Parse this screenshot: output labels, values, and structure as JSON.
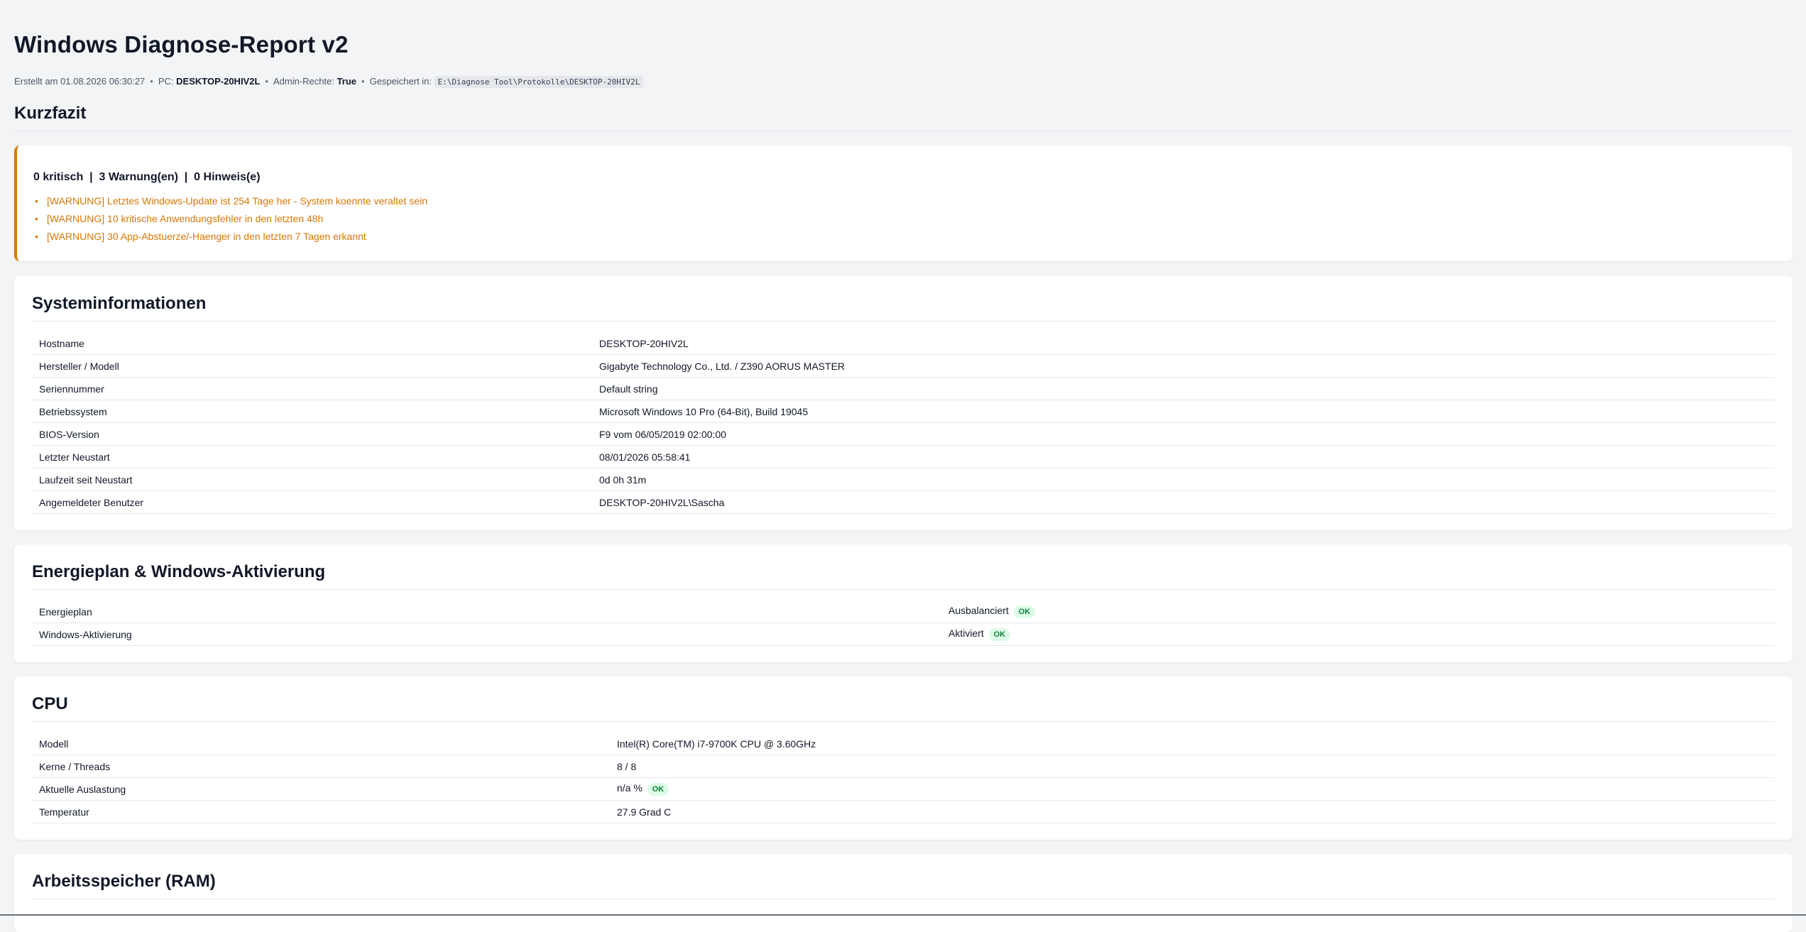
{
  "header": {
    "title": "Windows Diagnose-Report v2",
    "created_label": "Erstellt am 01.08.2026 06:30:27",
    "pc_label": "PC:",
    "pc_value": "DESKTOP-20HIV2L",
    "admin_label": "Admin-Rechte:",
    "admin_value": "True",
    "saved_label": "Gespeichert in:",
    "saved_path": "E:\\Diagnose Tool\\Protokolle\\DESKTOP-20HIV2L",
    "separator": "•"
  },
  "summary": {
    "title": "Kurzfazit",
    "counts": "0 kritisch  |  3 Warnung(en)  |  0 Hinweis(e)",
    "items": [
      "[WARNUNG] Letztes Windows-Update ist 254 Tage her - System koennte veraltet sein",
      "[WARNUNG] 10 kritische Anwendungsfehler in den letzten 48h",
      "[WARNUNG] 30 App-Abstuerze/-Haenger in den letzten 7 Tagen erkannt"
    ],
    "accent_color": "#d97706"
  },
  "system": {
    "title": "Systeminformationen",
    "rows": [
      {
        "label": "Hostname",
        "value": "DESKTOP-20HIV2L"
      },
      {
        "label": "Hersteller / Modell",
        "value": "Gigabyte Technology Co., Ltd. / Z390 AORUS MASTER"
      },
      {
        "label": "Seriennummer",
        "value": "Default string"
      },
      {
        "label": "Betriebssystem",
        "value": "Microsoft Windows 10 Pro (64-Bit), Build 19045"
      },
      {
        "label": "BIOS-Version",
        "value": "F9 vom 06/05/2019 02:00:00"
      },
      {
        "label": "Letzter Neustart",
        "value": "08/01/2026 05:58:41"
      },
      {
        "label": "Laufzeit seit Neustart",
        "value": "0d 0h 31m"
      },
      {
        "label": "Angemeldeter Benutzer",
        "value": "DESKTOP-20HIV2L\\Sascha"
      }
    ]
  },
  "energy": {
    "title": "Energieplan & Windows-Aktivierung",
    "rows": [
      {
        "label": "Energieplan",
        "value": "Ausbalanciert",
        "badge": "OK"
      },
      {
        "label": "Windows-Aktivierung",
        "value": "Aktiviert",
        "badge": "OK"
      }
    ]
  },
  "cpu": {
    "title": "CPU",
    "rows": [
      {
        "label": "Modell",
        "value": "Intel(R) Core(TM) i7-9700K CPU @ 3.60GHz"
      },
      {
        "label": "Kerne / Threads",
        "value": "8 / 8"
      },
      {
        "label": "Aktuelle Auslastung",
        "value": "n/a %",
        "badge": "OK"
      },
      {
        "label": "Temperatur",
        "value": "27.9 Grad C"
      }
    ]
  },
  "ram": {
    "title": "Arbeitsspeicher (RAM)"
  },
  "colors": {
    "ok_badge_bg": "#dcfce7",
    "ok_badge_text": "#15803d",
    "page_bg": "#f3f4f6"
  }
}
